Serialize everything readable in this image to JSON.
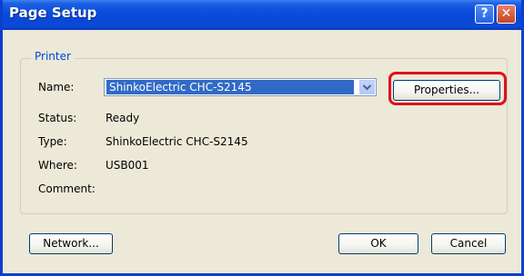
{
  "window": {
    "title": "Page Setup",
    "help_icon": "?",
    "close_icon": "✕"
  },
  "printer": {
    "group_label": "Printer",
    "name_label": "Name:",
    "name_value": "ShinkoElectric CHC-S2145",
    "properties_button": "Properties...",
    "status_label": "Status:",
    "status_value": "Ready",
    "type_label": "Type:",
    "type_value": "ShinkoElectric CHC-S2145",
    "where_label": "Where:",
    "where_value": "USB001",
    "comment_label": "Comment:",
    "comment_value": ""
  },
  "buttons": {
    "network": "Network...",
    "ok": "OK",
    "cancel": "Cancel"
  },
  "colors": {
    "titlebar": "#0a47d6",
    "highlight": "#e0101e",
    "selection": "#316ac5",
    "group_label": "#0046d5"
  }
}
